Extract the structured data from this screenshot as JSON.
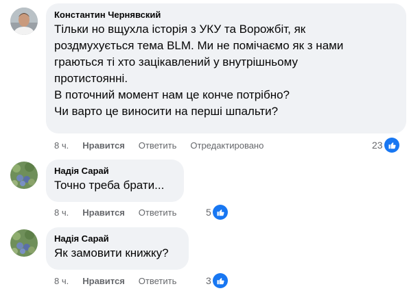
{
  "comments": [
    {
      "author": "Константин Чернявский",
      "lines": [
        "Тільки но вщухла історія з УКУ та Ворожбіт, як",
        "роздмухується тема BLM. Ми не помічаємо як з нами",
        "граються ті хто зацікавлений у внутрішньому",
        "протистоянні.",
        "В поточний момент нам це конче потрібно?",
        "Чи варто це виносити на перші шпальти?"
      ],
      "time": "8 ч.",
      "like_label": "Нравится",
      "reply_label": "Ответить",
      "edited_label": "Отредактировано",
      "reaction_count": "23",
      "reaction_icon": "like-icon"
    },
    {
      "author": "Надія Сарай",
      "lines": [
        "Точно треба брати..."
      ],
      "time": "8 ч.",
      "like_label": "Нравится",
      "reply_label": "Ответить",
      "reaction_count": "5",
      "reaction_icon": "like-icon"
    },
    {
      "author": "Надія Сарай",
      "lines": [
        "Як замовити книжку?"
      ],
      "time": "8 ч.",
      "like_label": "Нравится",
      "reply_label": "Ответить",
      "reaction_count": "3",
      "reaction_icon": "like-icon"
    }
  ],
  "colors": {
    "bubble": "#f0f2f5",
    "meta_text": "#65676b",
    "like_blue": "#1877f2"
  }
}
